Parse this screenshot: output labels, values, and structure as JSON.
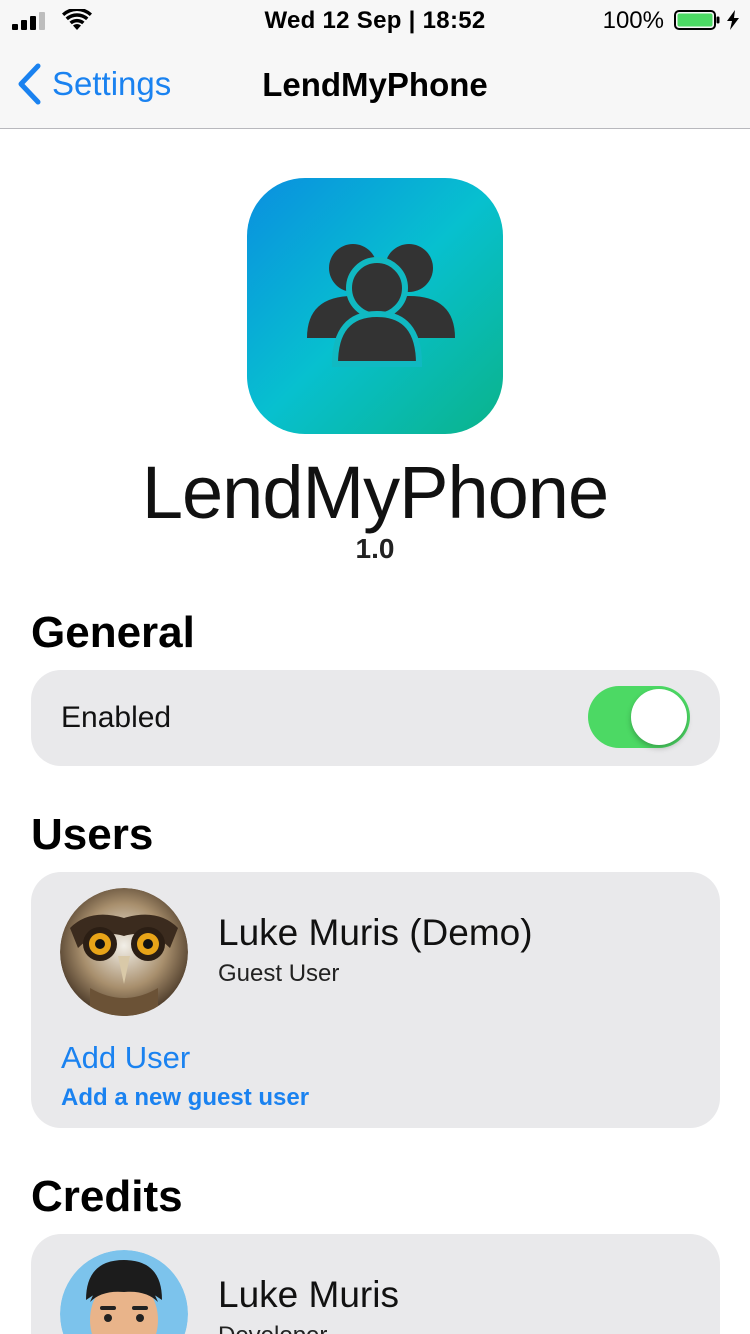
{
  "status_bar": {
    "time": "Wed 12 Sep | 18:52",
    "battery_percent": "100%",
    "battery_level": 1.0
  },
  "nav": {
    "back_label": "Settings",
    "title": "LendMyPhone"
  },
  "header": {
    "app_name": "LendMyPhone",
    "version": "1.0"
  },
  "sections": {
    "general": {
      "title": "General",
      "enabled_label": "Enabled",
      "enabled": true
    },
    "users": {
      "title": "Users",
      "items": [
        {
          "name": "Luke Muris (Demo)",
          "role": "Guest User",
          "avatar": "owl-avatar"
        }
      ],
      "add_user_label": "Add User",
      "add_user_subtitle": "Add a new guest user"
    },
    "credits": {
      "title": "Credits",
      "items": [
        {
          "name": "Luke Muris",
          "role": "Developer",
          "avatar": "cartoon-man-avatar"
        }
      ]
    }
  },
  "colors": {
    "accent": "#1a82f0",
    "toggle_on": "#4cd964",
    "card_bg": "#e9e9eb",
    "nav_bg": "#f7f7f7"
  },
  "icons": [
    "signal-icon",
    "wifi-icon",
    "battery-icon",
    "charging-icon",
    "back-chevron-icon",
    "users-group-icon"
  ]
}
